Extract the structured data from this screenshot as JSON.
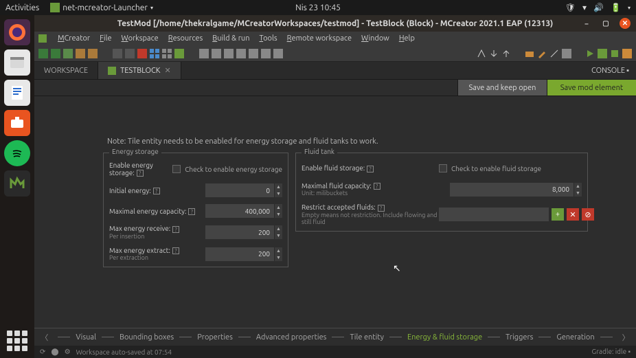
{
  "gnome": {
    "activities": "Activities",
    "appname": "net-mcreator-Launcher",
    "clock": "Nis 23  10:45"
  },
  "window": {
    "title": "TestMod [/home/thekralgame/MCreatorWorkspaces/testmod] - TestBlock (Block) - MCreator 2021.1 EAP (12313)"
  },
  "menubar": [
    "MCreator",
    "File",
    "Workspace",
    "Resources",
    "Build & run",
    "Tools",
    "Remote workspace",
    "Window",
    "Help"
  ],
  "tabs": {
    "workspace": "WORKSPACE",
    "testblock": "TESTBLOCK",
    "console": "CONSOLE"
  },
  "actions": {
    "keep": "Save and keep open",
    "save": "Save mod element"
  },
  "note": "Note: Tile entity needs to be enabled for energy storage and fluid tanks to work.",
  "energy": {
    "title": "Energy storage",
    "enable_label": "Enable energy storage:",
    "enable_check": "Check to enable energy storage",
    "initial_label": "Initial energy:",
    "initial_value": "0",
    "max_cap_label": "Maximal energy capacity:",
    "max_cap_value": "400,000",
    "max_recv_label": "Max energy receive:",
    "max_recv_sub": "Per insertion",
    "max_recv_value": "200",
    "max_ext_label": "Max energy extract:",
    "max_ext_sub": "Per extraction",
    "max_ext_value": "200"
  },
  "fluid": {
    "title": "Fluid tank",
    "enable_label": "Enable fluid storage:",
    "enable_check": "Check to enable fluid storage",
    "max_cap_label": "Maximal fluid capacity:",
    "max_cap_sub": "Unit: milibuckets",
    "max_cap_value": "8,000",
    "restrict_label": "Restrict accepted fluids:",
    "restrict_sub": "Empty means not restriction. Include flowing and still fluid"
  },
  "bottom_nav": [
    "Visual",
    "Bounding boxes",
    "Properties",
    "Advanced properties",
    "Tile entity",
    "Energy & fluid storage",
    "Triggers",
    "Generation"
  ],
  "bottom_nav_active": 5,
  "status": {
    "message": "Workspace auto-saved at 07:54",
    "gradle": "Gradle: idle"
  }
}
